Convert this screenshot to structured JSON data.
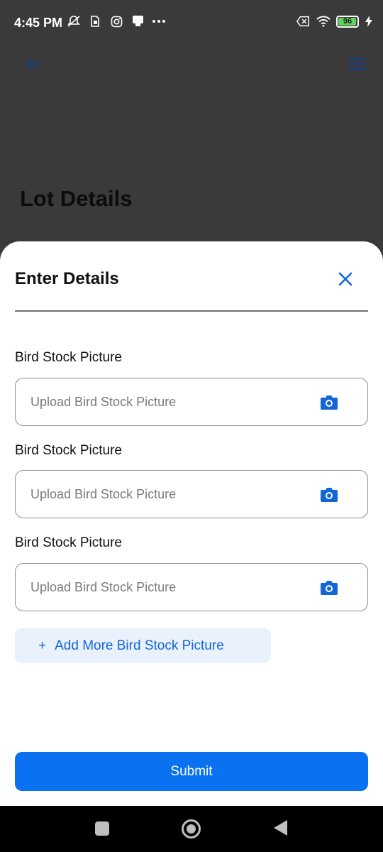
{
  "status_bar": {
    "time": "4:45 PM",
    "battery_level": "96",
    "left_icons": [
      "mute-icon",
      "sim-icon",
      "instagram-icon",
      "notification-icon",
      "more-dots-icon"
    ],
    "right_icons": [
      "sim-off-icon",
      "wifi-icon",
      "battery-icon",
      "charging-icon"
    ]
  },
  "app_bar": {
    "back_icon": "arrow-left-icon",
    "menu_icon": "hamburger-menu-icon",
    "accent": "#1466d8"
  },
  "page": {
    "title": "Lot Details"
  },
  "sheet": {
    "title": "Enter Details",
    "close_icon": "close-icon",
    "fields": [
      {
        "label": "Bird Stock Picture",
        "placeholder": "Upload Bird Stock Picture",
        "icon": "camera-icon"
      },
      {
        "label": "Bird Stock Picture",
        "placeholder": "Upload Bird Stock Picture",
        "icon": "camera-icon"
      },
      {
        "label": "Bird Stock Picture",
        "placeholder": "Upload Bird Stock Picture",
        "icon": "camera-icon"
      }
    ],
    "add_more": {
      "plus": "+",
      "label": "Add More Bird Stock Picture"
    },
    "submit_label": "Submit",
    "primary_color": "#0a72f0",
    "add_more_bg": "#e8f1fc"
  },
  "nav_bar": {
    "recents_icon": "recents-square-icon",
    "home_icon": "home-circle-icon",
    "back_icon": "back-triangle-icon"
  }
}
